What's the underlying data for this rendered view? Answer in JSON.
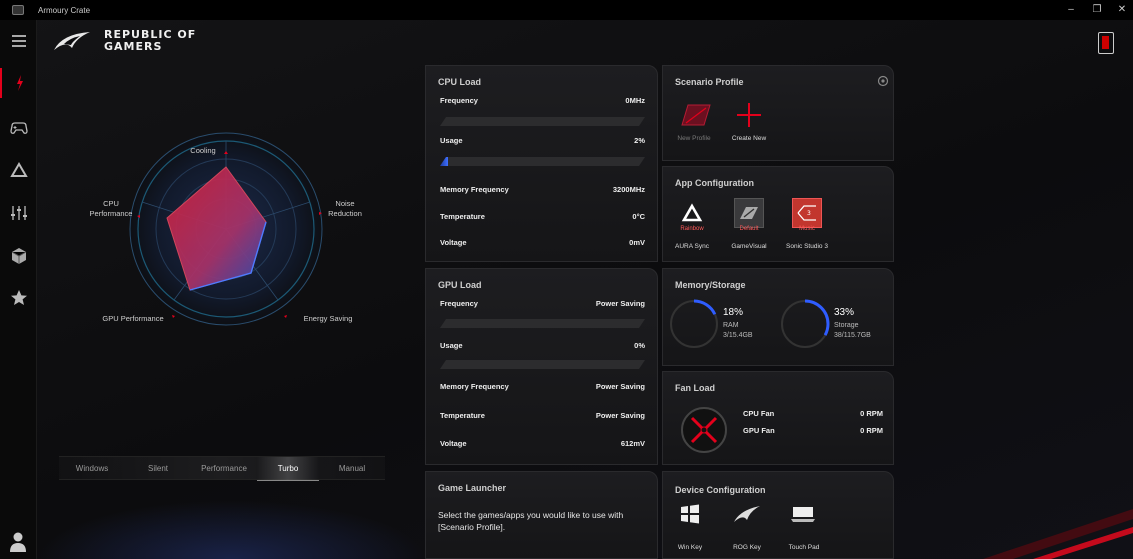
{
  "window": {
    "title": "Armoury Crate"
  },
  "brand": {
    "line1": "REPUBLIC OF",
    "line2": "GAMERS"
  },
  "radar": {
    "labels": {
      "cooling": "Cooling",
      "noise": "Noise\nReduction",
      "energy": "Energy Saving",
      "gpu": "GPU Performance",
      "cpu": "CPU\nPerformance"
    }
  },
  "modes": [
    {
      "label": "Windows",
      "active": false
    },
    {
      "label": "Silent",
      "active": false
    },
    {
      "label": "Performance",
      "active": false
    },
    {
      "label": "Turbo",
      "active": true
    },
    {
      "label": "Manual",
      "active": false
    }
  ],
  "cpu": {
    "title": "CPU Load",
    "frequency_label": "Frequency",
    "frequency_value": "0MHz",
    "frequency_fill": 0,
    "usage_label": "Usage",
    "usage_value": "2%",
    "usage_fill": 0.02,
    "memfreq_label": "Memory Frequency",
    "memfreq_value": "3200MHz",
    "temp_label": "Temperature",
    "temp_value": "0°C",
    "voltage_label": "Voltage",
    "voltage_value": "0mV"
  },
  "gpu": {
    "title": "GPU Load",
    "frequency_label": "Frequency",
    "frequency_value": "Power Saving",
    "frequency_fill": 0,
    "usage_label": "Usage",
    "usage_value": "0%",
    "usage_fill": 0,
    "memfreq_label": "Memory Frequency",
    "memfreq_value": "Power Saving",
    "temp_label": "Temperature",
    "temp_value": "Power Saving",
    "voltage_label": "Voltage",
    "voltage_value": "612mV"
  },
  "game_launcher": {
    "title": "Game Launcher",
    "text": "Select the games/apps you would like to use with [Scenario Profile]."
  },
  "scenario": {
    "title": "Scenario Profile",
    "new_profile": "New Profile",
    "create_new": "Create New"
  },
  "app_config": {
    "title": "App Configuration",
    "apps": [
      {
        "name": "AURA Sync",
        "tag": "Rainbow"
      },
      {
        "name": "GameVisual",
        "tag": "Default"
      },
      {
        "name": "Sonic Studio 3",
        "tag": "Music"
      }
    ]
  },
  "memory": {
    "title": "Memory/Storage",
    "ram_pct": "18%",
    "ram_label": "RAM",
    "ram_detail": "3/15.4GB",
    "ram_fill": 0.18,
    "storage_pct": "33%",
    "storage_label": "Storage",
    "storage_detail": "38/115.7GB",
    "storage_fill": 0.33
  },
  "fan": {
    "title": "Fan Load",
    "cpu_label": "CPU Fan",
    "cpu_value": "0 RPM",
    "gpu_label": "GPU Fan",
    "gpu_value": "0 RPM"
  },
  "device": {
    "title": "Device Configuration",
    "items": [
      "Win Key",
      "ROG Key",
      "Touch Pad"
    ]
  },
  "colors": {
    "accent": "#e3001b",
    "blue": "#2f5dff",
    "panel": "#1a1a1c"
  }
}
